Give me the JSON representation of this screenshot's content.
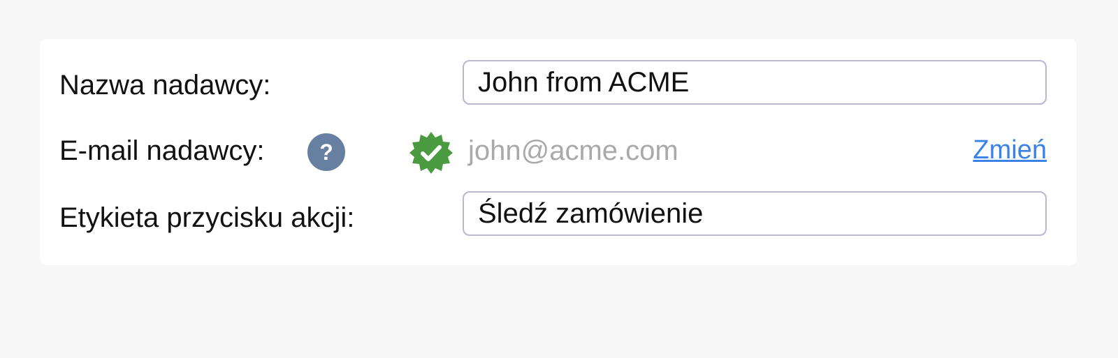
{
  "form": {
    "sender_name": {
      "label": "Nazwa nadawcy:",
      "value": "John from ACME"
    },
    "sender_email": {
      "label": "E-mail nadawcy:",
      "help_icon": "question-icon",
      "help_symbol": "?",
      "status_icon": "verified-badge-icon",
      "value": "john@acme.com",
      "change_link": "Zmień"
    },
    "action_button_label": {
      "label": "Etykieta przycisku akcji:",
      "value": "Śledź zamówienie"
    }
  },
  "colors": {
    "accent_link": "#3b82e6",
    "verified_green": "#4a9a3f",
    "help_icon_bg": "#677fa0",
    "input_border": "#b9b7d0"
  }
}
